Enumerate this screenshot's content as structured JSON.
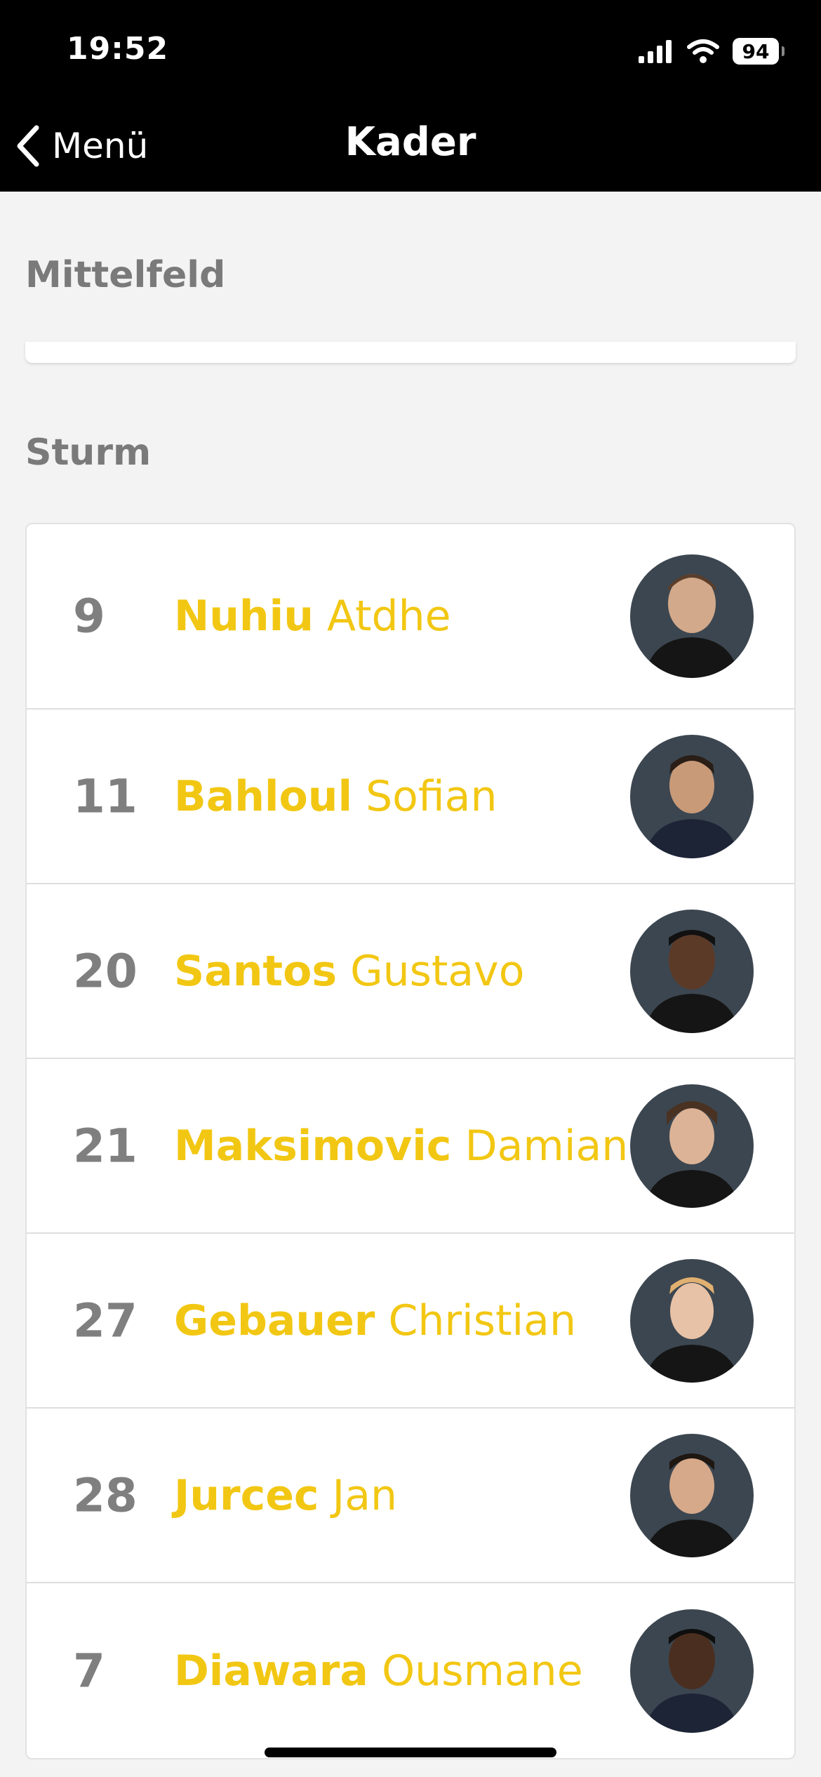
{
  "status_bar": {
    "time": "19:52",
    "battery": "94"
  },
  "nav": {
    "back_label": "Menü",
    "title": "Kader"
  },
  "sections": [
    {
      "title": "Mittelfeld"
    },
    {
      "title": "Sturm"
    }
  ],
  "players": [
    {
      "number": "9",
      "last": "Nuhiu",
      "first": "Atdhe"
    },
    {
      "number": "11",
      "last": "Bahloul",
      "first": "Sofian"
    },
    {
      "number": "20",
      "last": "Santos",
      "first": "Gustavo"
    },
    {
      "number": "21",
      "last": "Maksimovic",
      "first": "Damian"
    },
    {
      "number": "27",
      "last": "Gebauer",
      "first": "Christian"
    },
    {
      "number": "28",
      "last": "Jurcec",
      "first": "Jan"
    },
    {
      "number": "7",
      "last": "Diawara",
      "first": "Ousmane"
    }
  ],
  "colors": {
    "accent": "#f2c713",
    "header_bg": "#000000",
    "page_bg": "#f3f3f3"
  }
}
